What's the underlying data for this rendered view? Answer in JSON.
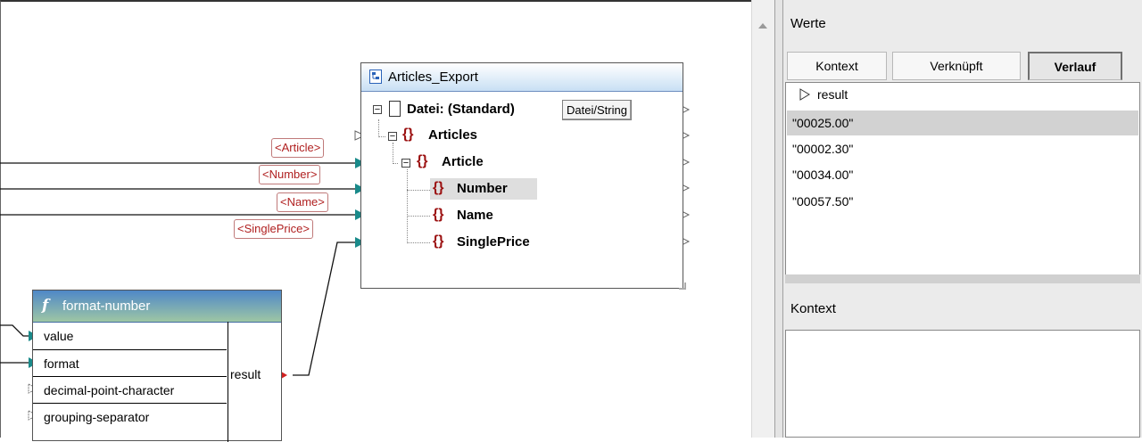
{
  "target": {
    "title": "Articles_Export",
    "file_row": {
      "label": "Datei: (Standard)",
      "button": "Datei/String"
    },
    "nodes": [
      {
        "name": "Articles"
      },
      {
        "name": "Article"
      },
      {
        "name": "Number"
      },
      {
        "name": "Name"
      },
      {
        "name": "SinglePrice"
      }
    ]
  },
  "connection_labels": [
    "<Article>",
    "<Number>",
    "<Name>",
    "<SinglePrice>"
  ],
  "function": {
    "title": "format-number",
    "inputs": [
      "value",
      "format",
      "decimal-point-character",
      "grouping-separator"
    ],
    "output": "result"
  },
  "panel": {
    "title": "Werte",
    "tabs": [
      {
        "label": "Kontext",
        "active": false
      },
      {
        "label": "Verknüpft",
        "active": false
      },
      {
        "label": "Verlauf",
        "active": true
      }
    ],
    "header": "result",
    "values": [
      "\"00025.00\"",
      "\"00002.30\"",
      "\"00034.00\"",
      "\"00057.50\""
    ],
    "selected_index": 0,
    "context_title": "Kontext"
  },
  "colors": {
    "connector_in": "#1a8a8a",
    "connector_out": "#d02020",
    "label_text": "#b02020",
    "header_gradient_end": "#c8dff4"
  }
}
